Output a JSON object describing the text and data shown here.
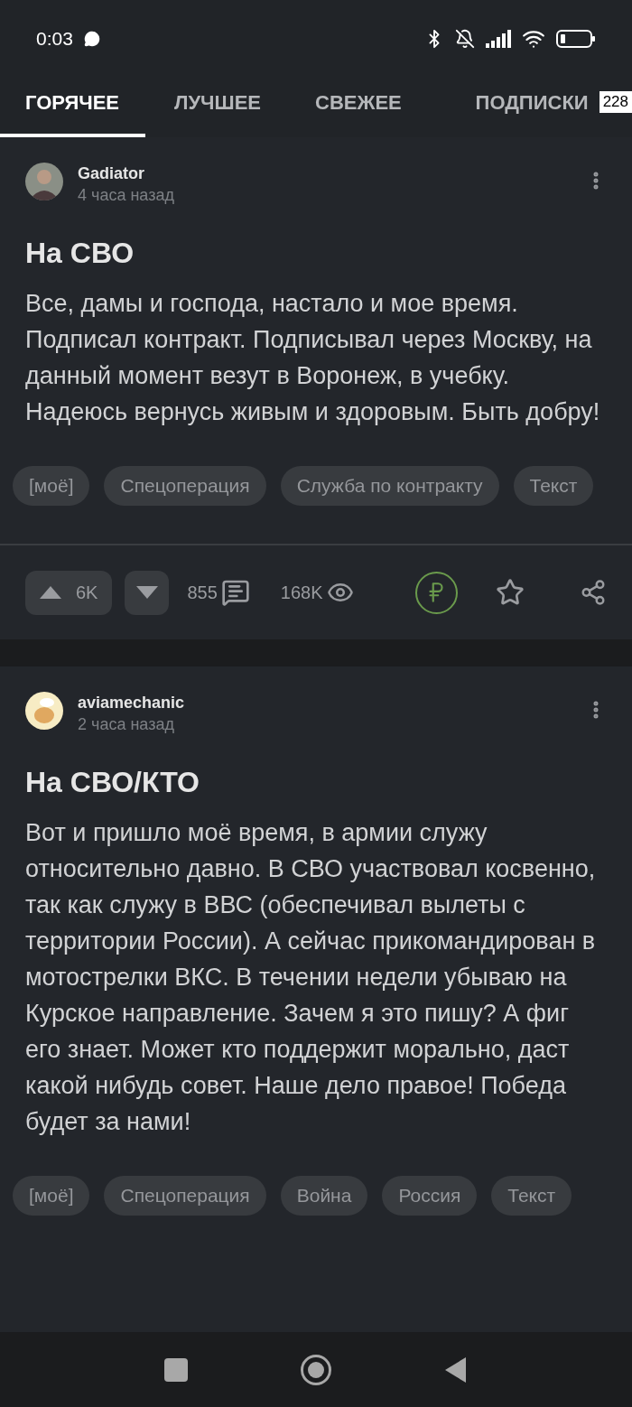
{
  "status_bar": {
    "time": "0:03"
  },
  "tabs": [
    {
      "label": "ГОРЯЧЕЕ",
      "selected": true
    },
    {
      "label": "ЛУЧШЕЕ",
      "selected": false
    },
    {
      "label": "СВЕЖЕЕ",
      "selected": false
    },
    {
      "label": "ПОДПИСКИ",
      "selected": false,
      "badge": "228"
    }
  ],
  "posts": [
    {
      "author": "Gadiator",
      "time": "4 часа назад",
      "avatar": {
        "kind": "picture"
      },
      "title": "На СВО",
      "body": "Все, дамы и господа, настало и мое время. Подписал контракт. Подписывал через Москву, на данный момент везут в Воронеж, в учебку. Надеюсь вернусь живым и здоровым. Быть добру!",
      "tags": [
        "[моё]",
        "Спецоперация",
        "Служба по контракту",
        "Текст"
      ],
      "footer": {
        "upvotes": "6K",
        "comments": "855",
        "views": "168K"
      }
    },
    {
      "author": "aviamechanic",
      "time": "2 часа назад",
      "avatar": {
        "kind": "picture"
      },
      "title": "На СВО/КТО",
      "body": "Вот и пришло моё время, в армии служу относительно давно. В СВО участвовал косвенно, так как служу в ВВС (обеспечивал вылеты с территории России). А сейчас прикомандирован в мотострелки ВКС. В течении недели убываю на Курское направление. Зачем я это пишу? А фиг его знает. Может кто поддержит морально, даст какой нибудь совет. Наше дело правое! Победа будет за нами!",
      "tags": [
        "[моё]",
        "Спецоперация",
        "Война",
        "Россия",
        "Текст"
      ]
    }
  ]
}
